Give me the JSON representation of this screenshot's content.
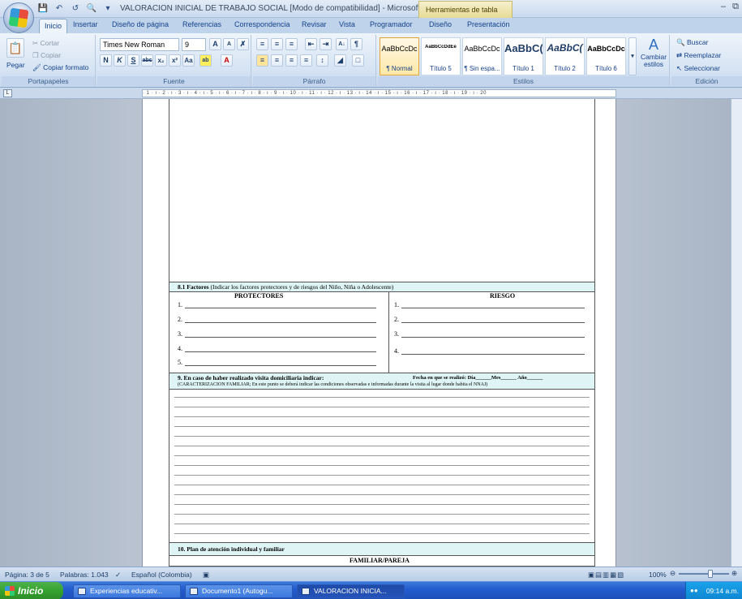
{
  "window": {
    "title": "VALORACION INICIAL DE TRABAJO SOCIAL [Modo de compatibilidad] - Microsoft Wo...",
    "context_tab_label": "Herramientas de tabla",
    "controls": {
      "minimize": "–",
      "restore": "⧉"
    }
  },
  "tabs": [
    {
      "label": "Inicio",
      "active": true
    },
    {
      "label": "Insertar"
    },
    {
      "label": "Diseño de página"
    },
    {
      "label": "Referencias"
    },
    {
      "label": "Correspondencia"
    },
    {
      "label": "Revisar"
    },
    {
      "label": "Vista"
    },
    {
      "label": "Programador"
    },
    {
      "label": "Diseño"
    },
    {
      "label": "Presentación"
    }
  ],
  "ribbon": {
    "clipboard": {
      "label": "Portapapeles",
      "paste": "Pegar",
      "cut": "Cortar",
      "copy": "Copiar",
      "format_painter": "Copiar formato"
    },
    "font": {
      "label": "Fuente",
      "name": "Times New Roman",
      "size": "9"
    },
    "paragraph": {
      "label": "Párrafo"
    },
    "styles": {
      "label": "Estilos",
      "items": [
        {
          "sample": "AaBbCcDc",
          "name": "¶ Normal"
        },
        {
          "sample": "AaBbCcDdEe",
          "name": "Título 5"
        },
        {
          "sample": "AaBbCcDc",
          "name": "¶ Sin espa..."
        },
        {
          "sample": "AaBbC(",
          "name": "Título 1"
        },
        {
          "sample": "AaBbC(",
          "name": "Título 2"
        },
        {
          "sample": "AaBbCcDc",
          "name": "Título 6"
        }
      ],
      "change_styles": "Cambiar estilos"
    },
    "editing": {
      "label": "Edición",
      "find": "Buscar",
      "replace": "Reemplazar",
      "select": "Seleccionar"
    }
  },
  "ruler": {
    "marks": "· 1 · ı · 2 · ı · 3 · ı · 4 · ı · 5 · ı · 6 · ı · 7 · ı · 8 · ı · 9 · ı · 10 · ı · 11 · ı · 12 · ı · 13 · ı · 14 · ı · 15 · ı · 16 · ı · 17 · ı · 18 · ı · 19 · ı · 20"
  },
  "document": {
    "section_81": {
      "number": "8.1 Factores",
      "text": "(Indicar los factores protectores y de riesgos del Niño, Niña o Adolescente)"
    },
    "protectores_label": "PROTECTORES",
    "riesgo_label": "RIESGO",
    "protectores_items": [
      "1.",
      "2.",
      "3.",
      "4.",
      "5."
    ],
    "riesgo_items": [
      "1.",
      "2.",
      "3.",
      "4."
    ],
    "section_9": {
      "heading": "9. En caso de haber realizado visita domiciliaria indicar:",
      "date_label": "Fecha en que se realizó: Día______Mes______ Año______",
      "subtext": "(CARACTERIZACION FAMILIAR; En este punto se deberá indicar las condiciones observadas e informadas durante la visita al lugar donde habita el NNAJ)"
    },
    "section_10": {
      "heading": "10. Plan de atención individual y familiar"
    },
    "familiar_label": "FAMILIAR/PAREJA"
  },
  "statusbar": {
    "page": "Página: 3 de 5",
    "words": "Palabras: 1.043",
    "language": "Español (Colombia)",
    "zoom": "100%"
  },
  "taskbar": {
    "start": "Inicio",
    "tasks": [
      {
        "label": "Experiencias educativ..."
      },
      {
        "label": "Documento1 (Autogu..."
      },
      {
        "label": "VALORACION INICIA...",
        "active": true
      }
    ],
    "clock": "09:14 a.m."
  },
  "colors": {
    "ribbon_blue": "#15428b",
    "form_band": "#dff5f5",
    "taskbar": "#245dd0"
  }
}
